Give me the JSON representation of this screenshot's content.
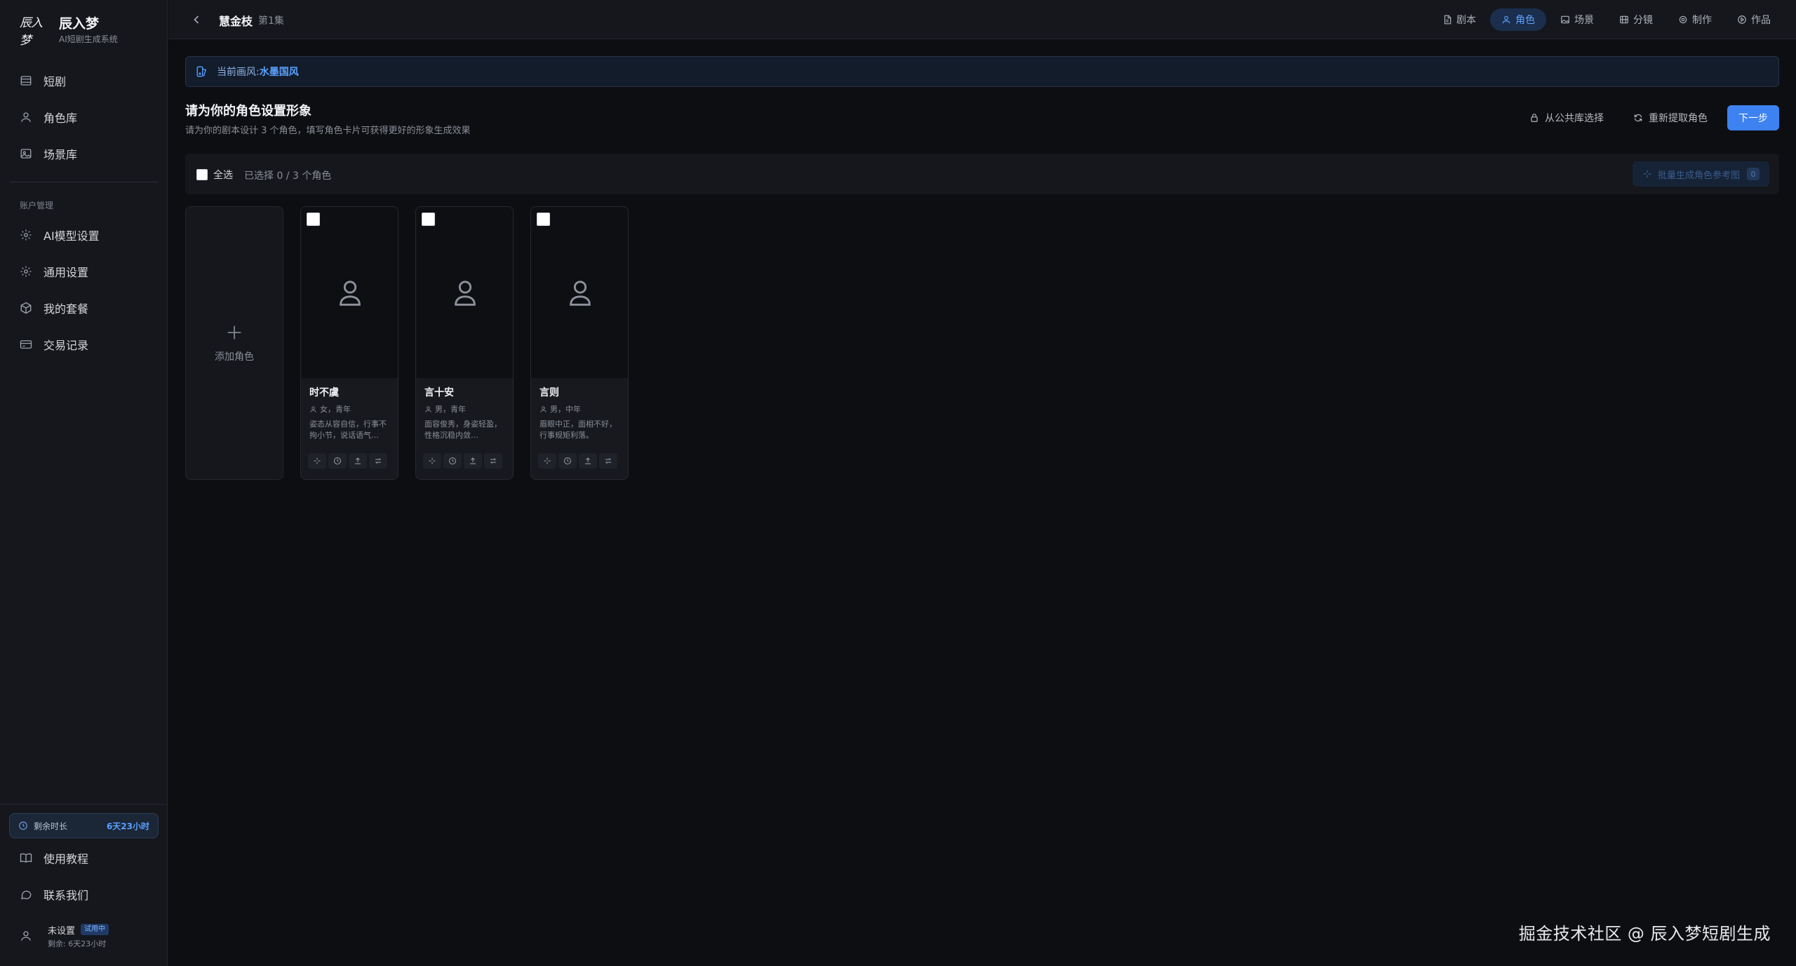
{
  "brand": {
    "logo_text": "辰入梦",
    "name": "辰入梦",
    "subtitle": "AI短剧生成系统"
  },
  "sidebar": {
    "main_items": [
      {
        "label": "短剧",
        "icon": "film-icon"
      },
      {
        "label": "角色库",
        "icon": "user-icon"
      },
      {
        "label": "场景库",
        "icon": "image-icon"
      }
    ],
    "section_label": "账户管理",
    "account_items": [
      {
        "label": "AI模型设置",
        "icon": "gear-icon"
      },
      {
        "label": "通用设置",
        "icon": "gear-icon"
      },
      {
        "label": "我的套餐",
        "icon": "package-icon"
      },
      {
        "label": "交易记录",
        "icon": "card-icon"
      }
    ],
    "trial": {
      "label": "剩余时长",
      "value": "6天23小时"
    },
    "bottom_items": [
      {
        "label": "使用教程",
        "icon": "book-icon"
      },
      {
        "label": "联系我们",
        "icon": "chat-icon"
      }
    ],
    "user": {
      "name": "未设置",
      "badge": "试用中",
      "remaining": "剩余: 6天23小时"
    }
  },
  "topbar": {
    "title": "慧金枝",
    "episode": "第1集",
    "steps": [
      {
        "label": "剧本",
        "icon": "document-icon",
        "active": false
      },
      {
        "label": "角色",
        "icon": "user-icon",
        "active": true
      },
      {
        "label": "场景",
        "icon": "image-icon",
        "active": false
      },
      {
        "label": "分镜",
        "icon": "film-icon",
        "active": false
      },
      {
        "label": "制作",
        "icon": "gear-icon",
        "active": false
      },
      {
        "label": "作品",
        "icon": "play-icon",
        "active": false
      }
    ]
  },
  "main": {
    "style_banner": {
      "label": "当前画风: ",
      "value": "水墨国风"
    },
    "section_title": "请为你的角色设置形象",
    "section_subtitle": "请为你的剧本设计 3 个角色，填写角色卡片可获得更好的形象生成效果",
    "actions": {
      "public_library": "从公共库选择",
      "re_extract": "重新提取角色",
      "next": "下一步"
    },
    "selection": {
      "select_all": "全选",
      "selected_count": "已选择 0 / 3 个角色",
      "batch_generate": "批量生成角色参考图",
      "batch_count": "0"
    },
    "add_card_label": "添加角色",
    "characters": [
      {
        "name": "时不虞",
        "meta": "女，青年",
        "desc": "姿态从容自信，行事不拘小节，说话语气…"
      },
      {
        "name": "言十安",
        "meta": "男，青年",
        "desc": "面容俊秀，身姿轻盈，性格沉稳内敛…"
      },
      {
        "name": "言则",
        "meta": "男，中年",
        "desc": "眉眼中正，面相不好，行事规矩利落。"
      }
    ]
  },
  "watermark": "掘金技术社区 @ 辰入梦短剧生成"
}
